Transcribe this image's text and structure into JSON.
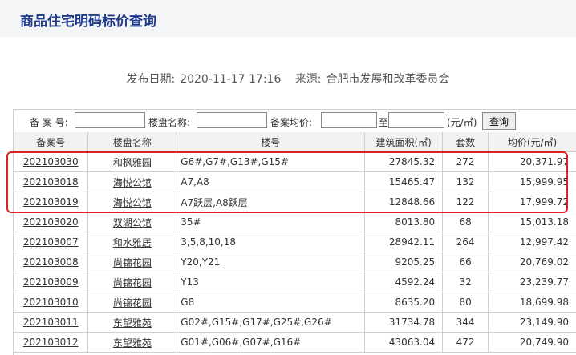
{
  "page_title": "商品住宅明码标价查询",
  "publish": {
    "date_label": "发布日期:",
    "date_value": "2020-11-17 17:16",
    "source_label": "来源:",
    "source_value": "合肥市发展和改革委员会"
  },
  "search": {
    "record_label": "备 案 号:",
    "name_label": "楼盘名称:",
    "price_label": "备案均价:",
    "to_label": "至",
    "unit_label": "(元/㎡)",
    "query_button": "查询",
    "record_value": "",
    "name_value": "",
    "price_from_value": "",
    "price_to_value": ""
  },
  "table": {
    "columns": [
      "备案号",
      "楼盘名称",
      "楼号",
      "建筑面积(㎡)",
      "套数",
      "均价(元/㎡)"
    ],
    "rows": [
      [
        "202103030",
        "和枫雅园",
        "G6#,G7#,G13#,G15#",
        "27845.32",
        "272",
        "20,371.97"
      ],
      [
        "202103018",
        "海悦公馆",
        "A7,A8",
        "15465.47",
        "132",
        "15,999.95"
      ],
      [
        "202103019",
        "海悦公馆",
        "A7跃层,A8跃层",
        "12848.66",
        "122",
        "17,999.72"
      ],
      [
        "202103020",
        "双湖公馆",
        "35#",
        "8013.80",
        "68",
        "15,013.18"
      ],
      [
        "202103007",
        "和水雅居",
        "3,5,8,10,18",
        "28942.11",
        "264",
        "12,997.42"
      ],
      [
        "202103008",
        "尚锦花园",
        "Y20,Y21",
        "9205.25",
        "66",
        "20,769.02"
      ],
      [
        "202103009",
        "尚锦花园",
        "Y13",
        "4592.24",
        "32",
        "23,239.77"
      ],
      [
        "202103010",
        "尚锦花园",
        "G8",
        "8635.20",
        "80",
        "18,699.98"
      ],
      [
        "202103011",
        "东望雅苑",
        "G02#,G15#,G17#,G25#,G26#",
        "31734.78",
        "344",
        "23,149.90"
      ],
      [
        "202103012",
        "东望雅苑",
        "G01#,G06#,G07#,G16#",
        "43063.04",
        "472",
        "20,749.90"
      ]
    ]
  },
  "colors": {
    "title": "#1f3a8a",
    "highlight": "#e02020",
    "header_bg": "#f2f2f2"
  }
}
